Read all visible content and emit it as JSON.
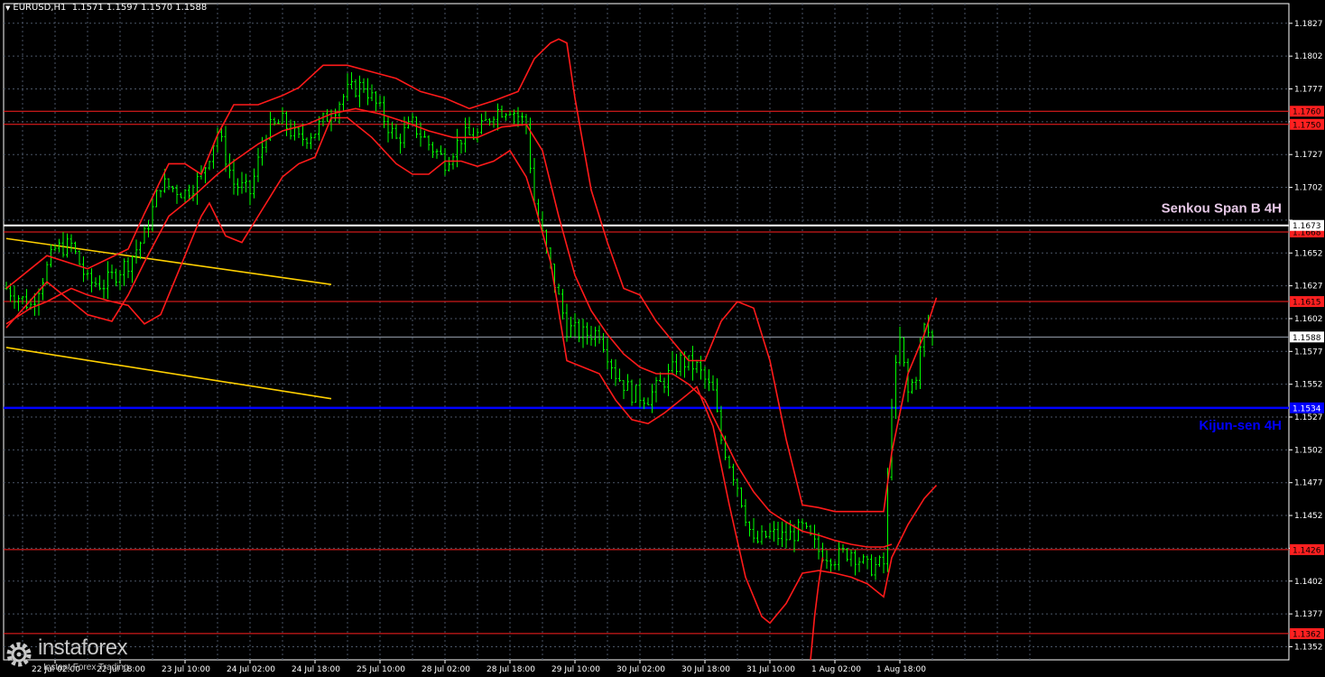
{
  "header": {
    "symbol": "EURUSD,H1",
    "ohlc": "1.1571 1.1597 1.1570 1.1588"
  },
  "brand": {
    "name": "instaforex",
    "tagline": "Instant Forex Trading",
    "color": "#c8c8c8"
  },
  "colors": {
    "background": "#000000",
    "grid": "#4a5566",
    "axis": "#ffffff",
    "candle": "#00ff00",
    "bands": "#ff1a1a",
    "level": "#ff2020",
    "trend": "#ffd000",
    "kijun": "#0000ff",
    "senkou": "#ffffff",
    "senkou_label": "#e6c8e6",
    "kijun_label": "#0000ff"
  },
  "chart_data": {
    "type": "candlestick",
    "symbol": "EURUSD",
    "timeframe": "H1",
    "ylim": [
      1.1342,
      1.1842
    ],
    "grid": true,
    "y_ticks": [
      1.1352,
      1.1377,
      1.1402,
      1.1427,
      1.1452,
      1.1477,
      1.1502,
      1.1527,
      1.1552,
      1.1577,
      1.1602,
      1.1627,
      1.1652,
      1.1677,
      1.1702,
      1.1727,
      1.1752,
      1.1777,
      1.1802,
      1.1827
    ],
    "y_tick_labels": [
      "1.1352",
      "1.1377",
      "1.1402",
      "",
      "1.1452",
      "1.1477",
      "1.1502",
      "1.1527",
      "1.1552",
      "1.1577",
      "1.1602",
      "1.1627",
      "1.1652",
      "",
      "1.1702",
      "1.1727",
      "",
      "1.1777",
      "1.1802",
      "1.1827"
    ],
    "x_tick_labels": [
      {
        "label": "22 Jul 02:00",
        "bar": 12
      },
      {
        "label": "22 Jul 18:00",
        "bar": 28
      },
      {
        "label": "23 Jul 10:00",
        "bar": 44
      },
      {
        "label": "24 Jul 02:00",
        "bar": 60
      },
      {
        "label": "24 Jul 18:00",
        "bar": 76
      },
      {
        "label": "25 Jul 10:00",
        "bar": 92
      },
      {
        "label": "28 Jul 02:00",
        "bar": 108
      },
      {
        "label": "28 Jul 18:00",
        "bar": 124
      },
      {
        "label": "29 Jul 10:00",
        "bar": 140
      },
      {
        "label": "30 Jul 02:00",
        "bar": 156
      },
      {
        "label": "30 Jul 18:00",
        "bar": 172
      },
      {
        "label": "31 Jul 10:00",
        "bar": 188
      },
      {
        "label": "1 Aug 02:00",
        "bar": 204
      },
      {
        "label": "1 Aug 18:00",
        "bar": 220
      }
    ],
    "n_bars": 256,
    "price_path": [
      [
        0,
        1.1625
      ],
      [
        6,
        1.1612
      ],
      [
        12,
        1.1655
      ],
      [
        16,
        1.1658
      ],
      [
        20,
        1.163
      ],
      [
        24,
        1.1628
      ],
      [
        30,
        1.1645
      ],
      [
        34,
        1.1665
      ],
      [
        38,
        1.1705
      ],
      [
        44,
        1.1698
      ],
      [
        48,
        1.171
      ],
      [
        52,
        1.1745
      ],
      [
        56,
        1.1705
      ],
      [
        60,
        1.1698
      ],
      [
        64,
        1.1745
      ],
      [
        68,
        1.1752
      ],
      [
        72,
        1.1738
      ],
      [
        76,
        1.1745
      ],
      [
        80,
        1.176
      ],
      [
        84,
        1.1775
      ],
      [
        88,
        1.178
      ],
      [
        92,
        1.176
      ],
      [
        96,
        1.1738
      ],
      [
        100,
        1.175
      ],
      [
        104,
        1.1735
      ],
      [
        108,
        1.1722
      ],
      [
        112,
        1.174
      ],
      [
        116,
        1.1742
      ],
      [
        120,
        1.176
      ],
      [
        124,
        1.1763
      ],
      [
        128,
        1.175
      ],
      [
        130,
        1.169
      ],
      [
        134,
        1.164
      ],
      [
        138,
        1.1595
      ],
      [
        142,
        1.159
      ],
      [
        146,
        1.1592
      ],
      [
        150,
        1.156
      ],
      [
        154,
        1.1545
      ],
      [
        158,
        1.1542
      ],
      [
        162,
        1.1555
      ],
      [
        166,
        1.157
      ],
      [
        170,
        1.1565
      ],
      [
        174,
        1.1545
      ],
      [
        176,
        1.151
      ],
      [
        180,
        1.1475
      ],
      [
        184,
        1.143
      ],
      [
        188,
        1.1438
      ],
      [
        192,
        1.1435
      ],
      [
        196,
        1.1442
      ],
      [
        200,
        1.1425
      ],
      [
        204,
        1.142
      ],
      [
        208,
        1.1425
      ],
      [
        212,
        1.1412
      ],
      [
        216,
        1.1415
      ],
      [
        218,
        1.154
      ],
      [
        220,
        1.1585
      ],
      [
        222,
        1.1545
      ],
      [
        224,
        1.156
      ],
      [
        226,
        1.1595
      ],
      [
        228,
        1.1588
      ]
    ],
    "upper_band": [
      [
        0,
        1.1625
      ],
      [
        10,
        1.165
      ],
      [
        20,
        1.164
      ],
      [
        30,
        1.1655
      ],
      [
        34,
        1.1682
      ],
      [
        40,
        1.172
      ],
      [
        44,
        1.172
      ],
      [
        48,
        1.1712
      ],
      [
        52,
        1.1742
      ],
      [
        56,
        1.1765
      ],
      [
        62,
        1.1765
      ],
      [
        68,
        1.1772
      ],
      [
        72,
        1.1778
      ],
      [
        78,
        1.1795
      ],
      [
        84,
        1.1795
      ],
      [
        90,
        1.179
      ],
      [
        96,
        1.1785
      ],
      [
        102,
        1.1775
      ],
      [
        108,
        1.177
      ],
      [
        114,
        1.1762
      ],
      [
        120,
        1.1768
      ],
      [
        126,
        1.1775
      ],
      [
        130,
        1.18
      ],
      [
        134,
        1.1812
      ],
      [
        136,
        1.1815
      ],
      [
        138,
        1.1812
      ],
      [
        140,
        1.177
      ],
      [
        144,
        1.17
      ],
      [
        148,
        1.166
      ],
      [
        152,
        1.1625
      ],
      [
        156,
        1.162
      ],
      [
        160,
        1.16
      ],
      [
        164,
        1.1585
      ],
      [
        168,
        1.157
      ],
      [
        172,
        1.157
      ],
      [
        176,
        1.16
      ],
      [
        180,
        1.1615
      ],
      [
        184,
        1.161
      ],
      [
        188,
        1.157
      ],
      [
        192,
        1.151
      ],
      [
        196,
        1.146
      ],
      [
        200,
        1.1458
      ],
      [
        204,
        1.1455
      ],
      [
        208,
        1.1455
      ],
      [
        212,
        1.1455
      ],
      [
        216,
        1.1455
      ],
      [
        218,
        1.15
      ],
      [
        222,
        1.156
      ],
      [
        226,
        1.159
      ],
      [
        229,
        1.1618
      ]
    ],
    "lower_band": [
      [
        0,
        1.1598
      ],
      [
        6,
        1.161
      ],
      [
        10,
        1.1615
      ],
      [
        16,
        1.1625
      ],
      [
        20,
        1.162
      ],
      [
        26,
        1.1615
      ],
      [
        30,
        1.1612
      ],
      [
        34,
        1.1598
      ],
      [
        38,
        1.1605
      ],
      [
        44,
        1.165
      ],
      [
        48,
        1.168
      ],
      [
        50,
        1.169
      ],
      [
        54,
        1.1665
      ],
      [
        58,
        1.166
      ],
      [
        62,
        1.168
      ],
      [
        68,
        1.171
      ],
      [
        72,
        1.172
      ],
      [
        76,
        1.1725
      ],
      [
        80,
        1.1755
      ],
      [
        84,
        1.1755
      ],
      [
        90,
        1.174
      ],
      [
        96,
        1.172
      ],
      [
        100,
        1.1712
      ],
      [
        104,
        1.1712
      ],
      [
        108,
        1.1722
      ],
      [
        112,
        1.1722
      ],
      [
        116,
        1.1718
      ],
      [
        120,
        1.1722
      ],
      [
        124,
        1.173
      ],
      [
        128,
        1.171
      ],
      [
        130,
        1.169
      ],
      [
        134,
        1.1645
      ],
      [
        138,
        1.157
      ],
      [
        142,
        1.1565
      ],
      [
        146,
        1.156
      ],
      [
        150,
        1.154
      ],
      [
        154,
        1.1525
      ],
      [
        158,
        1.1522
      ],
      [
        162,
        1.153
      ],
      [
        166,
        1.154
      ],
      [
        170,
        1.155
      ],
      [
        174,
        1.152
      ],
      [
        178,
        1.146
      ],
      [
        182,
        1.1405
      ],
      [
        186,
        1.1375
      ],
      [
        188,
        1.137
      ],
      [
        192,
        1.1385
      ],
      [
        196,
        1.1408
      ],
      [
        200,
        1.141
      ],
      [
        204,
        1.1408
      ],
      [
        208,
        1.1405
      ],
      [
        212,
        1.14
      ],
      [
        216,
        1.139
      ],
      [
        218,
        1.142
      ],
      [
        222,
        1.1445
      ],
      [
        226,
        1.1465
      ],
      [
        229,
        1.1475
      ]
    ],
    "middle_line": [
      [
        0,
        1.1595
      ],
      [
        10,
        1.163
      ],
      [
        20,
        1.1605
      ],
      [
        26,
        1.16
      ],
      [
        30,
        1.162
      ],
      [
        34,
        1.1645
      ],
      [
        40,
        1.168
      ],
      [
        46,
        1.1695
      ],
      [
        52,
        1.1712
      ],
      [
        56,
        1.1722
      ],
      [
        62,
        1.1735
      ],
      [
        68,
        1.1745
      ],
      [
        74,
        1.175
      ],
      [
        80,
        1.1758
      ],
      [
        86,
        1.1762
      ],
      [
        92,
        1.1758
      ],
      [
        98,
        1.1752
      ],
      [
        104,
        1.1745
      ],
      [
        110,
        1.174
      ],
      [
        116,
        1.174
      ],
      [
        122,
        1.1748
      ],
      [
        128,
        1.175
      ],
      [
        132,
        1.173
      ],
      [
        136,
        1.168
      ],
      [
        140,
        1.1635
      ],
      [
        144,
        1.1608
      ],
      [
        148,
        1.159
      ],
      [
        152,
        1.1575
      ],
      [
        156,
        1.1565
      ],
      [
        160,
        1.156
      ],
      [
        164,
        1.156
      ],
      [
        168,
        1.1552
      ],
      [
        172,
        1.154
      ],
      [
        176,
        1.1515
      ],
      [
        180,
        1.149
      ],
      [
        184,
        1.147
      ],
      [
        188,
        1.1455
      ],
      [
        192,
        1.1447
      ],
      [
        196,
        1.144
      ],
      [
        200,
        1.1437
      ],
      [
        204,
        1.1433
      ],
      [
        208,
        1.143
      ],
      [
        212,
        1.1428
      ],
      [
        216,
        1.1428
      ],
      [
        218,
        1.143
      ]
    ],
    "lagging_line": [
      [
        198,
        1.1342
      ],
      [
        199,
        1.1375
      ],
      [
        200,
        1.14
      ],
      [
        201,
        1.142
      ]
    ],
    "levels": [
      {
        "price": 1.176,
        "label": "1.1760"
      },
      {
        "price": 1.175,
        "label": "1.1750"
      },
      {
        "price": 1.1668,
        "label": "1.1668"
      },
      {
        "price": 1.1615,
        "label": "1.1615"
      },
      {
        "price": 1.1426,
        "label": "1.1426"
      },
      {
        "price": 1.1362,
        "label": "1.1362"
      }
    ],
    "senkou_span_b": {
      "price": 1.1673,
      "label": "1.1673",
      "name": "Senkou Span B 4H"
    },
    "kijun_sen": {
      "price": 1.1534,
      "label": "1.1534",
      "name": "Kijun-sen 4H"
    },
    "current_price": {
      "price": 1.1588,
      "label": "1.1588"
    },
    "trend_lines": [
      {
        "from": [
          0,
          1.1663
        ],
        "to": [
          80,
          1.1628
        ]
      },
      {
        "from": [
          0,
          1.158
        ],
        "to": [
          80,
          1.1541
        ]
      }
    ]
  }
}
